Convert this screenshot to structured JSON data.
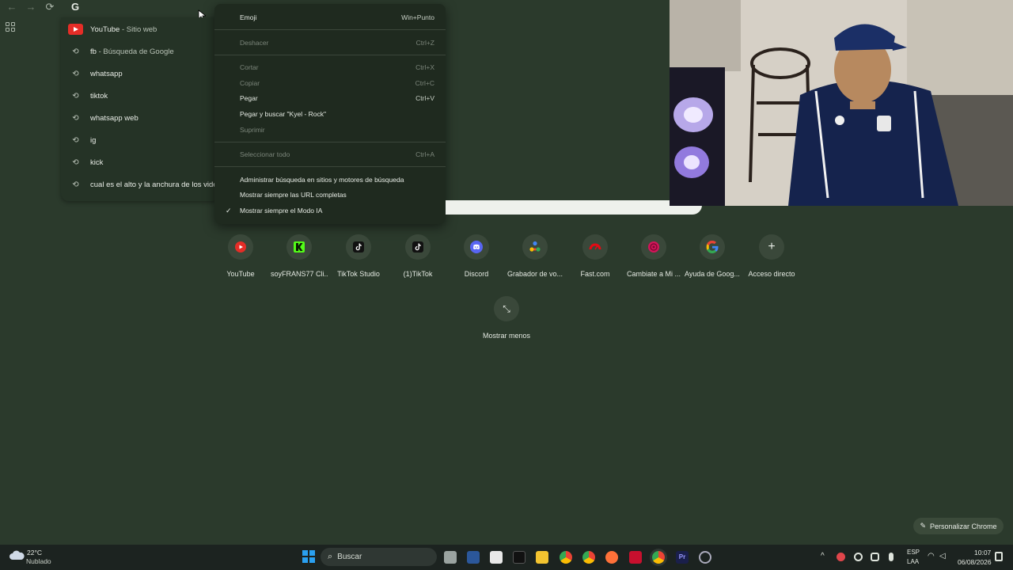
{
  "toolbar": {
    "back": "←",
    "forward": "→",
    "reload": "⟳",
    "omnibox_icon": "G"
  },
  "omnibox": {
    "suggestions": [
      {
        "text": "YouTube",
        "sep": " - ",
        "desc": "Sitio web",
        "icon": "youtube-icon"
      },
      {
        "text": "fb",
        "sep": " - ",
        "desc": "Búsqueda de Google",
        "icon": "history-icon"
      },
      {
        "text": "whatsapp",
        "sep": "",
        "desc": "",
        "icon": "history-icon"
      },
      {
        "text": "tiktok",
        "sep": "",
        "desc": "",
        "icon": "history-icon"
      },
      {
        "text": "whatsapp web",
        "sep": "",
        "desc": "",
        "icon": "history-icon"
      },
      {
        "text": "ig",
        "sep": "",
        "desc": "",
        "icon": "history-icon"
      },
      {
        "text": "kick",
        "sep": "",
        "desc": "",
        "icon": "history-icon"
      },
      {
        "text": "cual es el alto y la anchura de los vide",
        "sep": "",
        "desc": "",
        "icon": "history-icon"
      }
    ]
  },
  "context_menu": {
    "items": [
      {
        "label": "Emoji",
        "shortcut": "Win+Punto",
        "enabled": true
      },
      {
        "label": "Deshacer",
        "shortcut": "Ctrl+Z",
        "enabled": false
      },
      {
        "label": "Cortar",
        "shortcut": "Ctrl+X",
        "enabled": false
      },
      {
        "label": "Copiar",
        "shortcut": "Ctrl+C",
        "enabled": false
      },
      {
        "label": "Pegar",
        "shortcut": "Ctrl+V",
        "enabled": true
      },
      {
        "label": "Pegar y buscar \"Kyel - Rock\"",
        "shortcut": "",
        "enabled": true
      },
      {
        "label": "Suprimir",
        "shortcut": "",
        "enabled": false
      },
      {
        "label": "Seleccionar todo",
        "shortcut": "Ctrl+A",
        "enabled": false
      },
      {
        "label": "Administrar búsqueda en sitios y motores de búsqueda",
        "shortcut": "",
        "enabled": true
      },
      {
        "label": "Mostrar siempre las URL completas",
        "shortcut": "",
        "enabled": true
      },
      {
        "label": "Mostrar siempre el Modo IA",
        "shortcut": "",
        "enabled": true,
        "checked": true
      }
    ],
    "check_mark": "✓"
  },
  "shortcuts": [
    {
      "label": "YouTube",
      "icon": "youtube-icon",
      "color": "#e52d27"
    },
    {
      "label": "soyFRANS77 Cli...",
      "icon": "kick-icon",
      "color": "#53fc18"
    },
    {
      "label": "TikTok Studio",
      "icon": "tiktok-icon",
      "color": "#ffffff"
    },
    {
      "label": "(1)TikTok",
      "icon": "tiktok-icon",
      "color": "#ffffff"
    },
    {
      "label": "Discord",
      "icon": "discord-icon",
      "color": "#5865f2"
    },
    {
      "label": "Grabador de vo...",
      "icon": "voice-recorder-icon",
      "color": "#34a853"
    },
    {
      "label": "Fast.com",
      "icon": "speedometer-icon",
      "color": "#e50914"
    },
    {
      "label": "Cambiate a Mi ...",
      "icon": "carrier-icon",
      "color": "#d4145a"
    },
    {
      "label": "Ayuda de Goog...",
      "icon": "google-icon",
      "color": "#4285f4"
    },
    {
      "label": "Acceso directo",
      "icon": "plus-icon",
      "color": "#e6ebe4"
    }
  ],
  "show_less": {
    "label": "Mostrar menos",
    "icon": "collapse-icon"
  },
  "customize": {
    "label": "Personalizar Chrome",
    "icon": "pencil-icon"
  },
  "taskbar": {
    "weather_temp": "22°C",
    "weather_desc": "Nublado",
    "search_placeholder": "Buscar",
    "lang_top": "ESP",
    "lang_bottom": "LAA",
    "time": "10:07",
    "date": "06/08/2026"
  }
}
